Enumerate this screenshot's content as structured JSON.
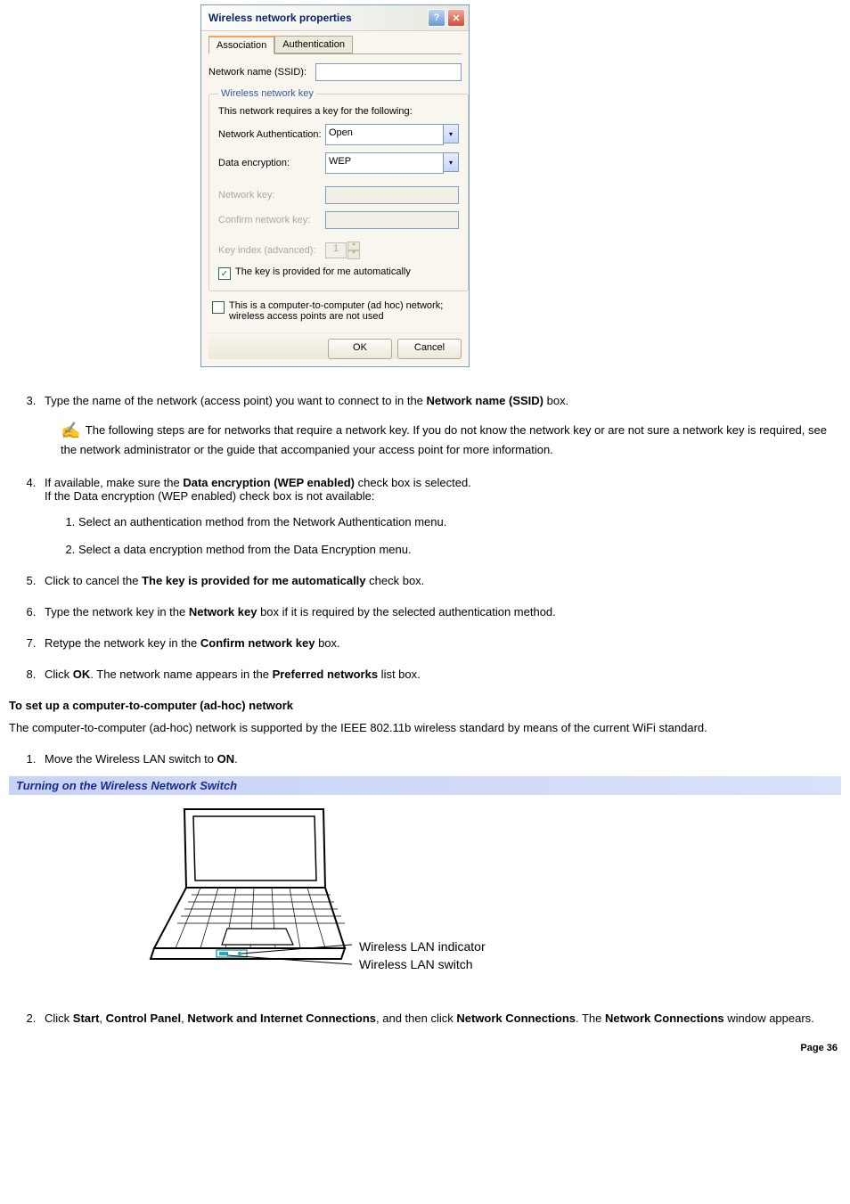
{
  "dialog": {
    "title": "Wireless network properties",
    "tabs": {
      "active": "Association",
      "inactive": "Authentication"
    },
    "ssid_label": "Network name (SSID):",
    "ssid_value": "",
    "group_legend": "Wireless network key",
    "group_intro": "This network requires a key for the following:",
    "auth_label": "Network Authentication:",
    "auth_value": "Open",
    "enc_label": "Data encryption:",
    "enc_value": "WEP",
    "netkey_label": "Network key:",
    "netkey_value": "",
    "confirmkey_label": "Confirm network key:",
    "confirmkey_value": "",
    "keyindex_label": "Key index (advanced):",
    "keyindex_value": "1",
    "auto_key_label": "The key is provided for me automatically",
    "auto_key_checked": true,
    "adhoc_label": "This is a computer-to-computer (ad hoc) network; wireless access points are not used",
    "adhoc_checked": false,
    "ok": "OK",
    "cancel": "Cancel"
  },
  "steps_a": {
    "s3": {
      "pre": "Type the name of the network (access point) you want to connect to in the ",
      "bold": "Network name (SSID)",
      "post": " box."
    },
    "note": " The following steps are for networks that require a network key. If you do not know the network key or are not sure a network key is required, see the network administrator or the guide that accompanied your access point for more information.",
    "s4_line1_pre": "If available, make sure the ",
    "s4_line1_bold": "Data encryption (WEP enabled)",
    "s4_line1_post": " check box is selected.",
    "s4_line2": "If the Data encryption (WEP enabled) check box is not available:",
    "s4_sub1": "Select an authentication method from the Network Authentication menu.",
    "s4_sub2": "Select a data encryption method from the Data Encryption menu.",
    "s5_pre": "Click to cancel the ",
    "s5_bold": "The key is provided for me automatically",
    "s5_post": " check box.",
    "s6_pre": "Type the network key in the ",
    "s6_bold": "Network key",
    "s6_post": " box if it is required by the selected authentication method.",
    "s7_pre": "Retype the network key in the ",
    "s7_bold": "Confirm network key",
    "s7_post": " box.",
    "s8_pre": "Click ",
    "s8_bold1": "OK",
    "s8_mid": ". The network name appears in the ",
    "s8_bold2": "Preferred networks",
    "s8_post": " list box."
  },
  "heading_adhoc": "To set up a computer-to-computer (ad-hoc) network",
  "para_adhoc": "The computer-to-computer (ad-hoc) network is supported by the IEEE 802.11b wireless standard by means of the current WiFi standard.",
  "steps_b": {
    "s1_pre": "Move the Wireless LAN switch to ",
    "s1_bold": "ON",
    "s1_post": ".",
    "s2_p1": "Click ",
    "s2_b1": "Start",
    "s2_p2": ", ",
    "s2_b2": "Control Panel",
    "s2_p3": ", ",
    "s2_b3": "Network and Internet Connections",
    "s2_p4": ", and then click ",
    "s2_b4": "Network Connections",
    "s2_p5": ". The ",
    "s2_b5": "Network Connections",
    "s2_p6": " window appears."
  },
  "bluebar": "Turning on the Wireless Network Switch",
  "callouts": {
    "indicator": "Wireless LAN indicator",
    "switch": "Wireless LAN switch"
  },
  "page": "Page 36"
}
